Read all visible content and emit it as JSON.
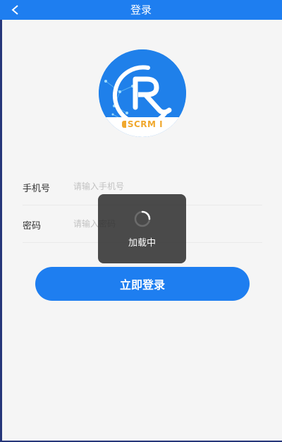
{
  "navbar": {
    "title": "登录",
    "back_icon": "chevron-left-icon"
  },
  "logo": {
    "badge_text": "SCRM I"
  },
  "form": {
    "phone": {
      "label": "手机号",
      "placeholder": "请输入手机号",
      "value": ""
    },
    "password": {
      "label": "密码",
      "placeholder": "请输入密码",
      "value": ""
    }
  },
  "login_button": {
    "label": "立即登录"
  },
  "loading_toast": {
    "text": "加载中",
    "icon": "spinner-icon"
  },
  "colors": {
    "primary": "#1e7ef0",
    "frame": "#26367a",
    "badge": "#f0a82e"
  }
}
